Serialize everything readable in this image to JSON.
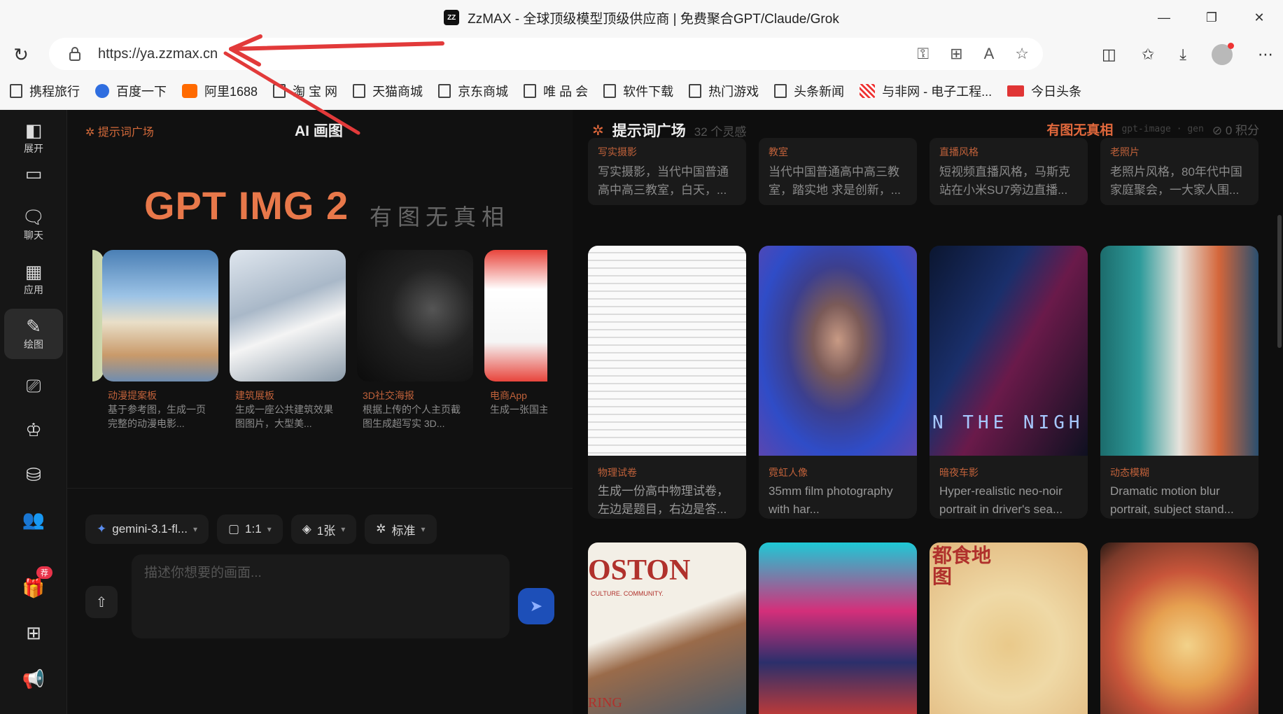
{
  "window": {
    "title": "ZzMAX - 全球顶级模型顶级供应商 | 免费聚合GPT/Claude/Grok",
    "favicon_text": "ZZ"
  },
  "address_bar": {
    "url": "https://ya.zzmax.cn"
  },
  "bookmarks": [
    "携程旅行",
    "百度一下",
    "阿里1688",
    "淘 宝 网",
    "天猫商城",
    "京东商城",
    "唯 品 会",
    "软件下载",
    "热门游戏",
    "头条新闻",
    "与非网 - 电子工程...",
    "今日头条"
  ],
  "sidebar": {
    "items": [
      {
        "label": "展开",
        "icon": "expand-icon"
      },
      {
        "label": "",
        "icon": "chat-bubble-icon"
      },
      {
        "label": "聊天",
        "icon": "chat-icon"
      },
      {
        "label": "应用",
        "icon": "apps-icon"
      },
      {
        "label": "绘图",
        "icon": "draw-icon"
      },
      {
        "label": "",
        "icon": "video-icon"
      },
      {
        "label": "",
        "icon": "crown-icon"
      },
      {
        "label": "",
        "icon": "database-icon"
      },
      {
        "label": "",
        "icon": "users-icon"
      },
      {
        "label": "",
        "icon": "gift-icon"
      },
      {
        "label": "",
        "icon": "grid-icon"
      },
      {
        "label": "",
        "icon": "megaphone-icon"
      }
    ],
    "badge": "荐"
  },
  "hero": {
    "crumb": "提示词广场",
    "page_title": "AI 画图",
    "headline": "GPT IMG 2",
    "tagline": "有图无真相",
    "carousel": [
      {
        "category": "",
        "desc": ""
      },
      {
        "category": "动漫提案板",
        "desc": "基于参考图，生成一页完整的动漫电影..."
      },
      {
        "category": "建筑展板",
        "desc": "生成一座公共建筑效果图图片，大型美..."
      },
      {
        "category": "3D社交海报",
        "desc": "根据上传的个人主页截图生成超写实 3D..."
      },
      {
        "category": "电商App",
        "desc": "生成一张国主流电"
      }
    ]
  },
  "toolbar": {
    "model": "gemini-3.1-fl...",
    "ratio": "1:1",
    "count": "1张",
    "quality": "标准"
  },
  "prompt": {
    "placeholder": "描述你想要的画面..."
  },
  "gallery": {
    "title": "提示词广场",
    "count": "32 个灵感",
    "brand": "有图无真相",
    "tags": "gpt-image · gen",
    "points": "0 积分",
    "text_cards": [
      {
        "category": "写实摄影",
        "desc": "写实摄影，当代中国普通高中高三教室，白天，..."
      },
      {
        "category": "教室",
        "desc": "当代中国普通高中高三教室，踏实地 求是创新，..."
      },
      {
        "category": "直播风格",
        "desc": "短视频直播风格，马斯克站在小米SU7旁边直播..."
      },
      {
        "category": "老照片",
        "desc": "老照片风格，80年代中国家庭聚会，一大家人围..."
      }
    ],
    "image_cards": [
      {
        "category": "物理试卷",
        "desc": "生成一份高中物理试卷，左边是题目，右边是答..."
      },
      {
        "category": "霓虹人像",
        "desc": "35mm film photography with har..."
      },
      {
        "category": "暗夜车影",
        "desc": "Hyper-realistic neo-noir portrait in driver's sea...",
        "overlay": "N THE NIGH"
      },
      {
        "category": "动态模糊",
        "desc": "Dramatic motion blur portrait, subject stand..."
      }
    ],
    "bottom_cards": [
      {
        "overlay": "OSTON",
        "sub": "CULTURE. COMMUNITY.",
        "foot": "RING"
      },
      {
        "overlay": ""
      },
      {
        "overlay": "都食地图"
      },
      {
        "overlay": ""
      }
    ]
  },
  "colors": {
    "accent": "#e0683c",
    "send": "#1d4fb8",
    "annotation": "#e23a3a"
  }
}
